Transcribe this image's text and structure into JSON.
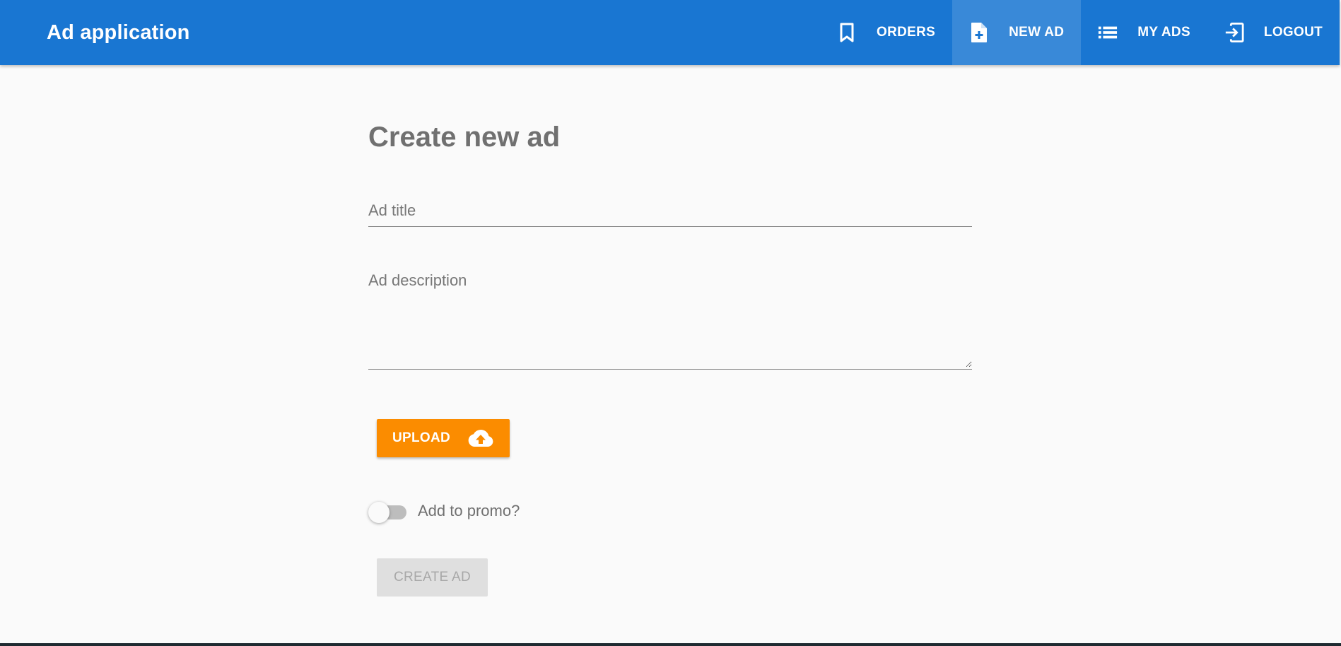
{
  "app": {
    "title": "Ad application"
  },
  "nav": {
    "items": [
      {
        "label": "ORDERS",
        "icon": "bookmark-icon",
        "active": false
      },
      {
        "label": "NEW AD",
        "icon": "note-add-icon",
        "active": true
      },
      {
        "label": "MY ADS",
        "icon": "list-icon",
        "active": false
      },
      {
        "label": "LOGOUT",
        "icon": "exit-to-app-icon",
        "active": false
      }
    ]
  },
  "form": {
    "heading": "Create new ad",
    "title_field": {
      "placeholder": "Ad title",
      "value": ""
    },
    "description_field": {
      "placeholder": "Ad description",
      "value": ""
    },
    "upload_label": "UPLOAD",
    "upload_icon": "cloud-upload-icon",
    "promo_label": "Add to promo?",
    "promo_on": false,
    "submit_label": "CREATE AD",
    "submit_disabled": true
  },
  "colors": {
    "toolbar": "#1976d2",
    "upload_button": "#fb8c00",
    "disabled_button": "#dfdfdf",
    "page_background": "#fafafa"
  }
}
